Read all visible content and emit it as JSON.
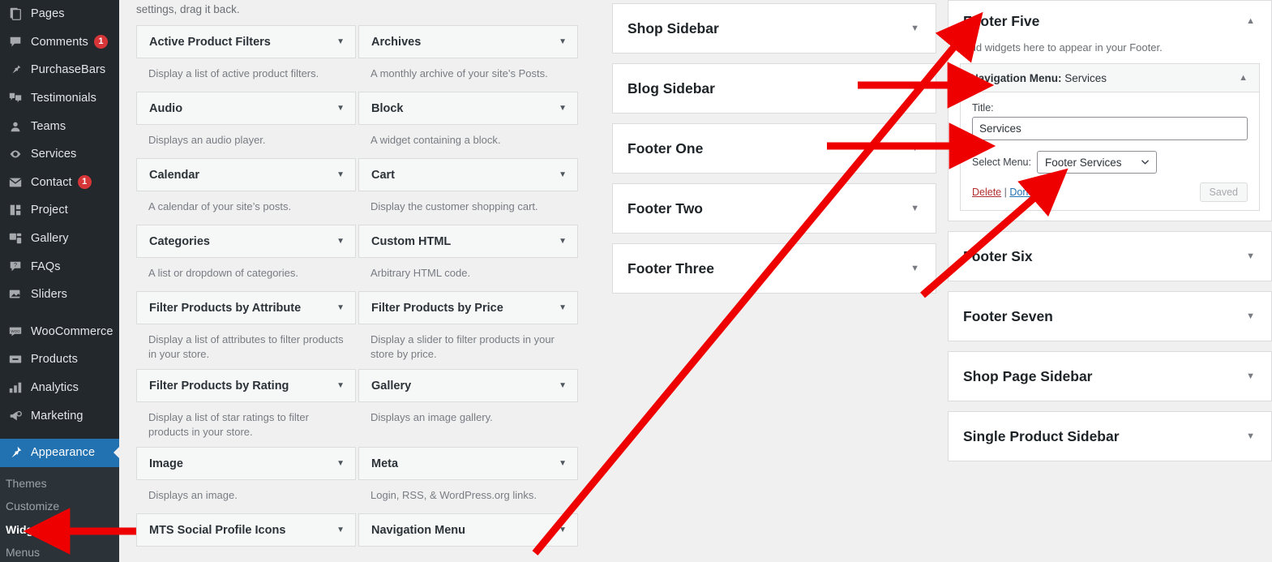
{
  "admin_sidebar": {
    "items": [
      {
        "label": "Pages",
        "icon": "pages-icon",
        "badge": null
      },
      {
        "label": "Comments",
        "icon": "comments-icon",
        "badge": "1"
      },
      {
        "label": "PurchaseBars",
        "icon": "pin-icon",
        "badge": null
      },
      {
        "label": "Testimonials",
        "icon": "testimonials-icon",
        "badge": null
      },
      {
        "label": "Teams",
        "icon": "teams-icon",
        "badge": null
      },
      {
        "label": "Services",
        "icon": "services-icon",
        "badge": null
      },
      {
        "label": "Contact",
        "icon": "mail-icon",
        "badge": "1"
      },
      {
        "label": "Project",
        "icon": "project-icon",
        "badge": null
      },
      {
        "label": "Gallery",
        "icon": "gallery-icon",
        "badge": null
      },
      {
        "label": "FAQs",
        "icon": "faqs-icon",
        "badge": null
      },
      {
        "label": "Sliders",
        "icon": "sliders-icon",
        "badge": null
      },
      {
        "label": "WooCommerce",
        "icon": "woocommerce-icon",
        "badge": null
      },
      {
        "label": "Products",
        "icon": "products-icon",
        "badge": null
      },
      {
        "label": "Analytics",
        "icon": "analytics-icon",
        "badge": null
      },
      {
        "label": "Marketing",
        "icon": "marketing-icon",
        "badge": null
      },
      {
        "label": "Appearance",
        "icon": "appearance-icon",
        "badge": null,
        "current": true
      }
    ],
    "submenu": [
      {
        "label": "Themes",
        "active": false
      },
      {
        "label": "Customize",
        "active": false
      },
      {
        "label": "Widgets",
        "active": true
      },
      {
        "label": "Menus",
        "active": false
      }
    ],
    "highlight_color": "#2271b1",
    "background_color": "#23282d",
    "badge_color": "#d63638"
  },
  "intro": {
    "text": "settings, drag it back."
  },
  "available_widgets": {
    "left_column": [
      {
        "name": "Active Product Filters",
        "desc": "Display a list of active product filters."
      },
      {
        "name": "Audio",
        "desc": "Displays an audio player."
      },
      {
        "name": "Calendar",
        "desc": "A calendar of your site’s posts."
      },
      {
        "name": "Categories",
        "desc": "A list or dropdown of categories."
      },
      {
        "name": "Filter Products by Attribute",
        "desc": "Display a list of attributes to filter products in your store."
      },
      {
        "name": "Filter Products by Rating",
        "desc": "Display a list of star ratings to filter products in your store."
      },
      {
        "name": "Image",
        "desc": "Displays an image."
      },
      {
        "name": "MTS Social Profile Icons",
        "desc": ""
      }
    ],
    "right_column": [
      {
        "name": "Archives",
        "desc": "A monthly archive of your site’s Posts."
      },
      {
        "name": "Block",
        "desc": "A widget containing a block."
      },
      {
        "name": "Cart",
        "desc": "Display the customer shopping cart."
      },
      {
        "name": "Custom HTML",
        "desc": "Arbitrary HTML code."
      },
      {
        "name": "Filter Products by Price",
        "desc": "Display a slider to filter products in your store by price."
      },
      {
        "name": "Gallery",
        "desc": "Displays an image gallery."
      },
      {
        "name": "Meta",
        "desc": "Login, RSS, & WordPress.org links."
      },
      {
        "name": "Navigation Menu",
        "desc": ""
      }
    ]
  },
  "middle_sidebars": [
    {
      "title": "Shop Sidebar"
    },
    {
      "title": "Blog Sidebar"
    },
    {
      "title": "Footer One"
    },
    {
      "title": "Footer Two"
    },
    {
      "title": "Footer Three"
    }
  ],
  "right_sidebars": {
    "expanded": {
      "title": "Footer Five",
      "toggle": "collapse",
      "description": "Add widgets here to appear in your Footer.",
      "widget": {
        "header_prefix": "Navigation Menu:",
        "header_value": "Services",
        "toggle": "collapse",
        "title_label": "Title:",
        "title_value": "Services",
        "select_label": "Select Menu:",
        "select_value": "Footer Services",
        "delete_link": "Delete",
        "separator": "|",
        "done_link": "Done",
        "save_button": "Saved"
      }
    },
    "collapsed": [
      {
        "title": "Footer Six"
      },
      {
        "title": "Footer Seven"
      },
      {
        "title": "Shop Page Sidebar"
      },
      {
        "title": "Single Product Sidebar"
      }
    ]
  },
  "annotations": {
    "color": "#ee0000",
    "arrow_count": 5,
    "notes": [
      "arrow pointing to Widgets submenu item",
      "arrow pointing to Footer Five panel title",
      "arrow pointing to Navigation Menu: Services widget header",
      "arrow pointing to Title input field",
      "arrow pointing to Select Menu dropdown"
    ]
  }
}
